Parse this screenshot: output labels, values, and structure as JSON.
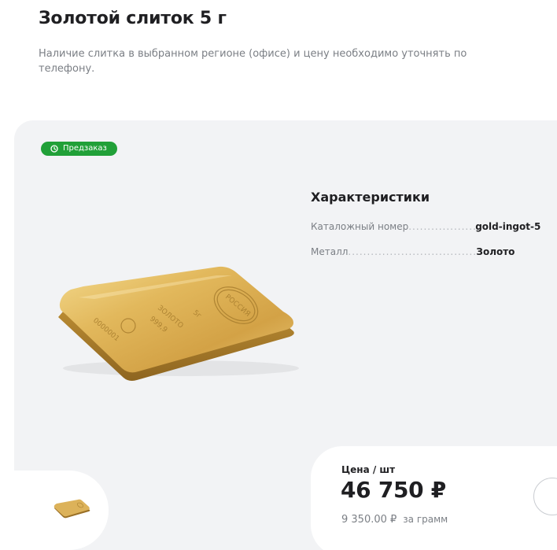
{
  "product": {
    "title": "Золотой слиток 5 г",
    "availability_note": "Наличие слитка в выбранном регионе (офисе) и цену необходимо уточнять по телефону.",
    "badge": {
      "label": "Предзаказ",
      "icon": "clock-icon",
      "color": "#21a038"
    }
  },
  "specs": {
    "title": "Характеристики",
    "rows": [
      {
        "label": "Каталожный номер",
        "value": "gold-ingot-5"
      },
      {
        "label": "Металл",
        "value": "Золото"
      }
    ]
  },
  "ingot": {
    "stamp_country": "РОССИЯ",
    "stamp_weight": "5г",
    "stamp_metal": "ЗОЛОТО",
    "stamp_fineness": "999,9",
    "stamp_serial": "0000001"
  },
  "price": {
    "label": "Цена / шт",
    "value": "46 750 ₽",
    "per_gram_value": "9 350.00 ₽",
    "per_gram_unit": "за грамм"
  },
  "colors": {
    "accent": "#21a038",
    "card_background": "#f2f3f5",
    "gold": "#d4a94e"
  }
}
